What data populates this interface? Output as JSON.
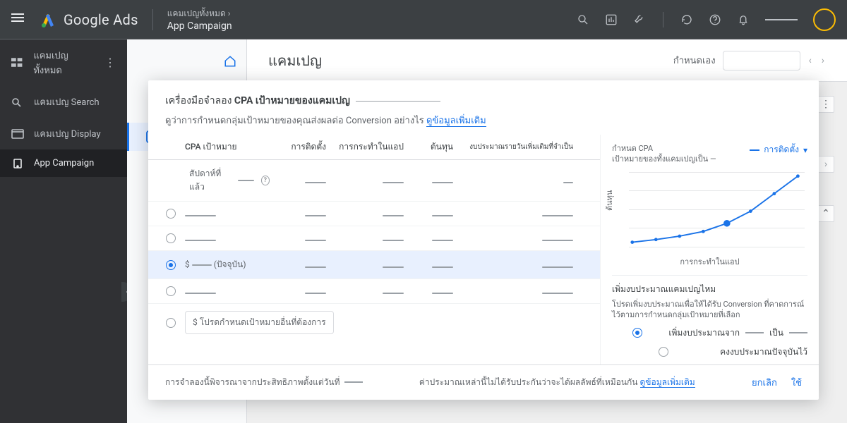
{
  "topbar": {
    "brand": "Google Ads",
    "crumb_top": "แคมเปญทั้งหมด ›",
    "crumb_sub": "App Campaign"
  },
  "leftnav": {
    "items": [
      {
        "label": "แคมเปญทั้งหมด"
      },
      {
        "label": "แคมเปญ Search"
      },
      {
        "label": "แคมเปญ Display"
      },
      {
        "label": "App Campaign"
      }
    ]
  },
  "pagebar": {
    "title": "แคมเปญ",
    "custom_label": "กำหนดเอง"
  },
  "modal": {
    "title_prefix": "เครื่องมือจำลอง ",
    "title_bold": "CPA เป้าหมายของแคมเปญ",
    "desc": "ดูว่าการกำหนดกลุ่มเป้าหมายของคุณส่งผลต่อ Conversion อย่างไร ",
    "learn_more": "ดูข้อมูลเพิ่มเติม",
    "columns": {
      "c1": "CPA เป้าหมาย",
      "c2": "การติดตั้ง",
      "c3": "การกระทำในแอป",
      "c4": "ต้นทุน",
      "c5": "งบประมาณรายวันเพิ่มเติมที่จำเป็น"
    },
    "last_week": "สัปดาห์ที่แล้ว",
    "current_marker": "(ปัจจุบัน)",
    "currency": "$",
    "custom_input": "$ โปรดกำหนดเป้าหมายอื่นที่ต้องการ",
    "chart": {
      "head1": "กำหนด CPA",
      "head2": "เป้าหมายของทั้งแคมเปญเป็น —",
      "metric": "การติดตั้ง",
      "ylabel": "ต้นทุน",
      "xlabel": "การกระทำในแอป"
    },
    "budget": {
      "title": "เพิ่มงบประมาณแคมเปญไหม",
      "desc": "โปรดเพิ่มงบประมาณเพื่อให้ได้รับ Conversion ที่คาดการณ์ไว้ตามการกำหนดกลุ่มเป้าหมายที่เลือก",
      "opt1_a": "เพิ่มงบประมาณจาก",
      "opt1_b": "เป็น",
      "opt2": "คงงบประมาณปัจจุบันไว้"
    },
    "footer": {
      "left": "การจำลองนี้พิจารณาจากประสิทธิภาพตั้งแต่วันที่",
      "mid": "ค่าประมาณเหล่านี้ไม่ได้รับประกันว่าจะได้ผลลัพธ์ที่เหมือนกัน ",
      "learn": "ดูข้อมูลเพิ่มเติม",
      "cancel": "ยกเลิก",
      "apply": "ใช้"
    }
  },
  "chart_data": {
    "type": "line",
    "x": [
      0,
      1,
      2,
      3,
      4,
      5,
      6,
      7
    ],
    "y": [
      6,
      8,
      11,
      16,
      24,
      36,
      58,
      92
    ],
    "highlight_index": 4,
    "xlabel": "การกระทำในแอป",
    "ylabel": "ต้นทุน",
    "ylim": [
      0,
      100
    ]
  }
}
